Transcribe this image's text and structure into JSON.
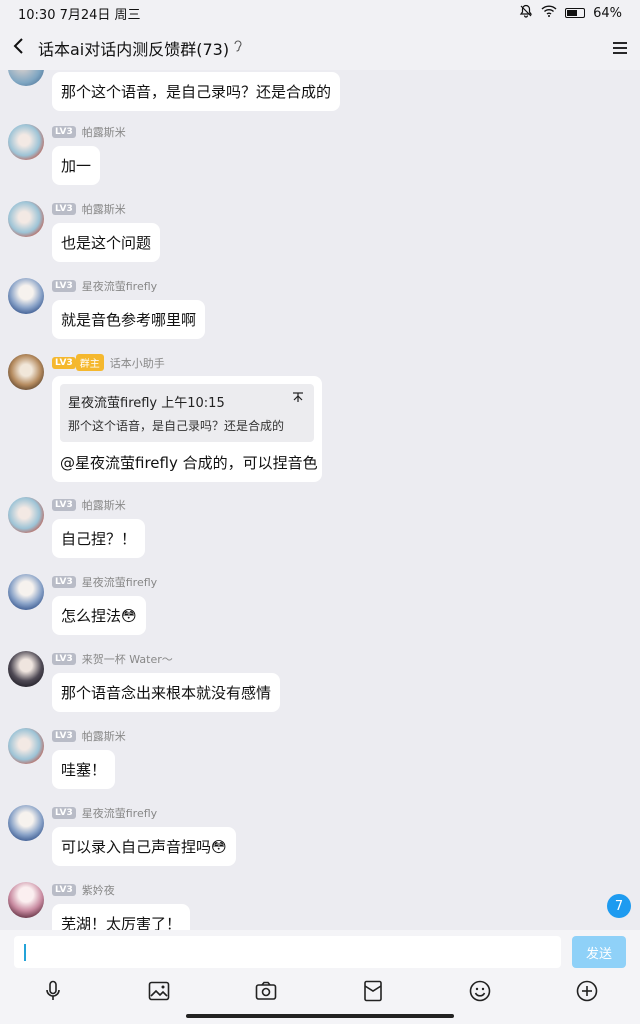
{
  "status_bar": {
    "time": "10:30 7月24日 周三",
    "battery": "64%",
    "battery_level": 0.64
  },
  "header": {
    "title": "话本ai对话内测反馈群(73)",
    "ear_icon": "ear-icon",
    "menu_icon": "menu-icon"
  },
  "messages": [
    {
      "sender": "",
      "level": "",
      "text": "那个这个语音，是自己录吗？还是合成的"
    },
    {
      "sender": "帕露斯米",
      "level": "LV3",
      "text": "加一"
    },
    {
      "sender": "帕露斯米",
      "level": "LV3",
      "text": "也是这个问题"
    },
    {
      "sender": "星夜流萤firefly",
      "level": "LV3",
      "text": "就是音色参考哪里啊"
    },
    {
      "sender": "话本小助手",
      "level": "LV3",
      "role": "群主",
      "quote": {
        "author_time": "星夜流萤firefly 上午10:15",
        "text": "那个这个语音，是自己录吗？还是合成的"
      },
      "text": "@星夜流萤firefly 合成的，可以捏音色"
    },
    {
      "sender": "帕露斯米",
      "level": "LV3",
      "text": "自己捏？！"
    },
    {
      "sender": "星夜流萤firefly",
      "level": "LV3",
      "text": "怎么捏法😳"
    },
    {
      "sender": "来贺一杯 Water～",
      "level": "LV3",
      "text": "那个语音念出来根本就没有感情"
    },
    {
      "sender": "帕露斯米",
      "level": "LV3",
      "text": "哇塞！"
    },
    {
      "sender": "星夜流萤firefly",
      "level": "LV3",
      "text": "可以录入自己声音捏吗😳"
    },
    {
      "sender": "紫妗夜",
      "level": "LV3",
      "text": "芜湖！太厉害了！"
    }
  ],
  "unread_count": "7",
  "composer": {
    "placeholder": "",
    "send_label": "发送"
  },
  "toolbar_icons": [
    "microphone-icon",
    "image-icon",
    "camera-icon",
    "red-packet-icon",
    "emoji-icon",
    "plus-icon"
  ]
}
